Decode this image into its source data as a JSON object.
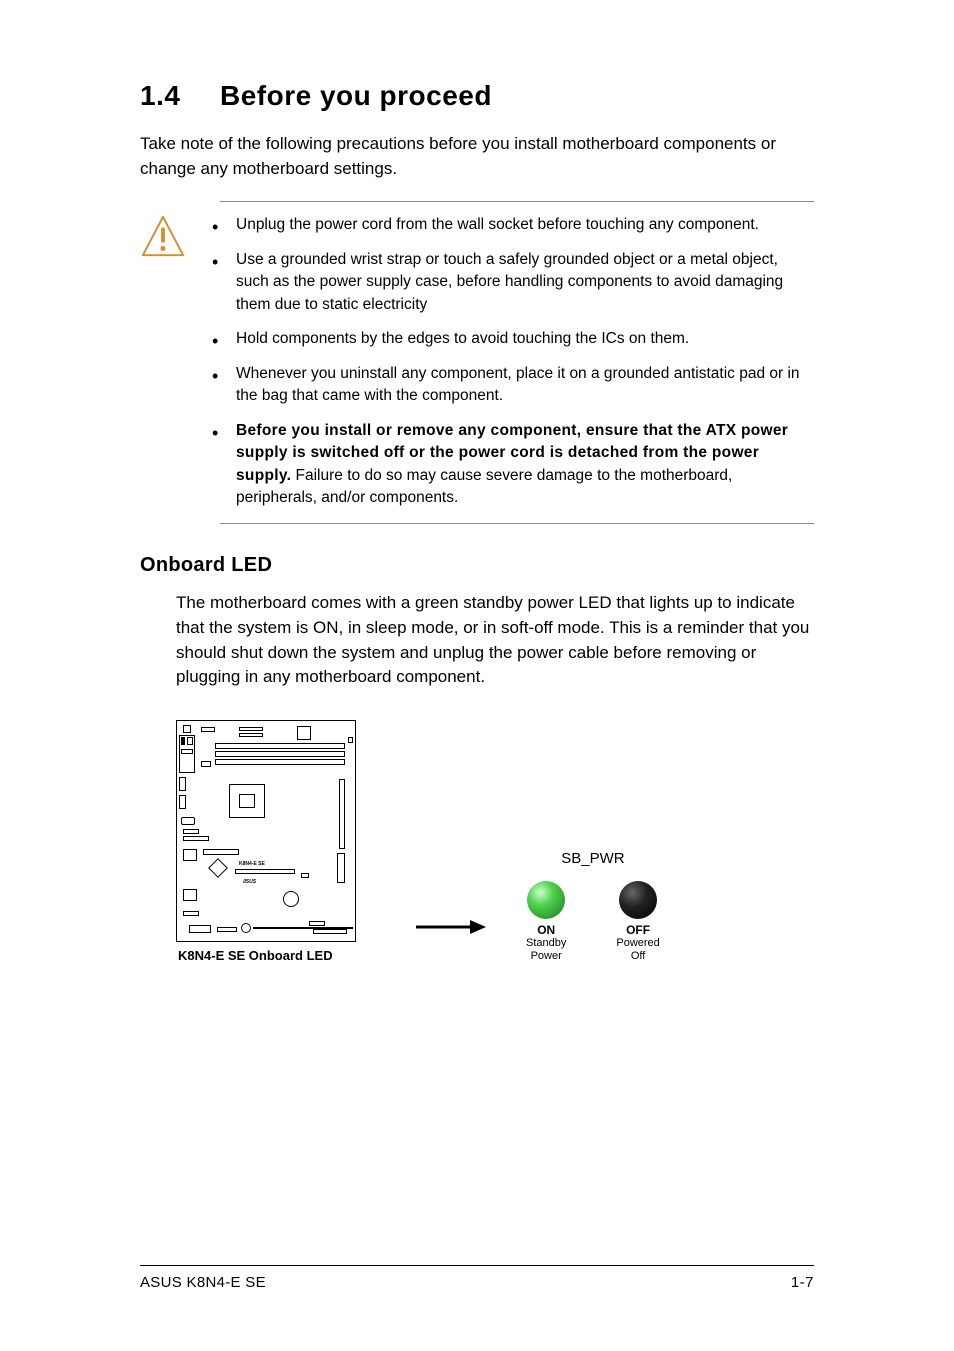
{
  "section": {
    "number": "1.4",
    "title": "Before you proceed"
  },
  "intro": "Take note of the following precautions before you install motherboard components or change any motherboard settings.",
  "bullets": [
    {
      "text": "Unplug the power cord from the wall socket before touching any component."
    },
    {
      "text": "Use a grounded wrist strap or touch a safely grounded object or a metal object, such as the power supply case, before handling components to avoid damaging them due to static electricity"
    },
    {
      "text": "Hold components by the edges to avoid touching the ICs on them."
    },
    {
      "text": "Whenever you uninstall any component, place it on a grounded antistatic pad or in the bag that came with the component."
    },
    {
      "bold": "Before you install or remove any component, ensure that the ATX power supply is switched off or the power cord is detached from the power supply.",
      "rest": " Failure to do so may cause severe damage to the motherboard, peripherals, and/or components."
    }
  ],
  "onboard": {
    "heading": "Onboard LED",
    "body": "The motherboard comes with a green standby power LED that lights up  to indicate that the system is ON, in sleep mode, or in soft-off mode. This is a reminder that you should shut down the system and unplug the power cable before removing or plugging in any motherboard component."
  },
  "diagram": {
    "board_model": "K8N4-E SE",
    "caption": "K8N4-E SE Onboard LED",
    "led_header": "SB_PWR",
    "on": {
      "label": "ON",
      "sub1": "Standby",
      "sub2": "Power"
    },
    "off": {
      "label": "OFF",
      "sub1": "Powered",
      "sub2": "Off"
    }
  },
  "footer": {
    "product": "ASUS K8N4-E SE",
    "page": "1-7"
  }
}
